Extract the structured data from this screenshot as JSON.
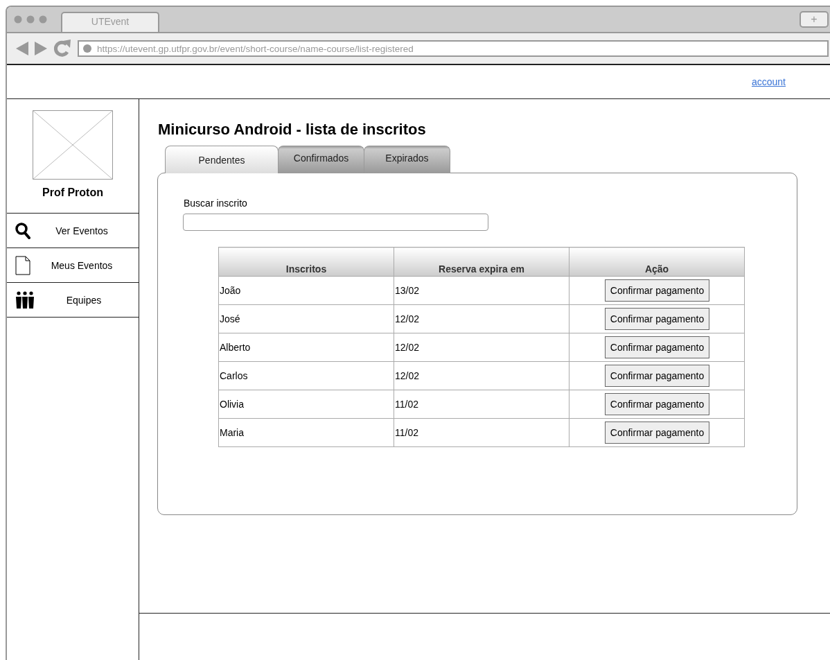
{
  "browser": {
    "tab_title": "UTEvent",
    "new_tab": "+",
    "url": "https://utevent.gp.utfpr.gov.br/event/short-course/name-course/list-registered"
  },
  "header": {
    "account_link": "account"
  },
  "sidebar": {
    "user_name": "Prof Proton",
    "items": [
      {
        "label": "Ver Eventos",
        "kind": "search"
      },
      {
        "label": "Meus Eventos",
        "kind": "document"
      },
      {
        "label": "Equipes",
        "kind": "team"
      }
    ]
  },
  "page_title": "Minicurso Android - lista de inscritos",
  "tabs": [
    {
      "label": "Pendentes",
      "selected": true
    },
    {
      "label": "Confirmados",
      "selected": false
    },
    {
      "label": "Expirados",
      "selected": false
    }
  ],
  "search": {
    "label": "Buscar inscrito"
  },
  "table": {
    "columns": [
      "Inscritos",
      "Reserva expira em",
      "Ação"
    ],
    "rows": [
      {
        "name": "João",
        "expires": "13/02",
        "action": "Confirmar pagamento"
      },
      {
        "name": "José",
        "expires": "12/02",
        "action": "Confirmar pagamento"
      },
      {
        "name": "Alberto",
        "expires": "12/02",
        "action": "Confirmar pagamento"
      },
      {
        "name": "Carlos",
        "expires": "12/02",
        "action": "Confirmar pagamento"
      },
      {
        "name": "Olivia",
        "expires": "11/02",
        "action": "Confirmar pagamento"
      },
      {
        "name": "Maria",
        "expires": "11/02",
        "action": "Confirmar pagamento"
      }
    ]
  }
}
